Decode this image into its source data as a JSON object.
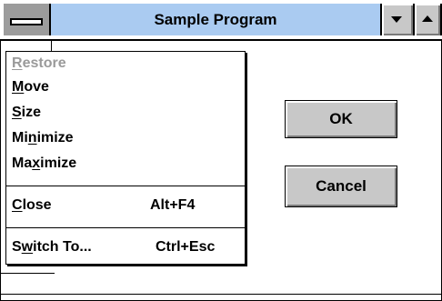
{
  "window": {
    "title": "Sample Program",
    "system_menu_icon": "system-menu-bar-icon",
    "minimize_icon": "arrow-down-icon",
    "maximize_icon": "arrow-up-icon"
  },
  "dialog": {
    "ok_label": "OK",
    "cancel_label": "Cancel"
  },
  "system_menu": {
    "items": [
      {
        "prefix": "",
        "mnemonic": "R",
        "suffix": "estore",
        "accel": "",
        "enabled": false
      },
      {
        "prefix": "",
        "mnemonic": "M",
        "suffix": "ove",
        "accel": "",
        "enabled": true
      },
      {
        "prefix": "",
        "mnemonic": "S",
        "suffix": "ize",
        "accel": "",
        "enabled": true
      },
      {
        "prefix": "Mi",
        "mnemonic": "n",
        "suffix": "imize",
        "accel": "",
        "enabled": true
      },
      {
        "prefix": "Ma",
        "mnemonic": "x",
        "suffix": "imize",
        "accel": "",
        "enabled": true
      },
      {
        "prefix": "",
        "mnemonic": "C",
        "suffix": "lose",
        "accel": "Alt+F4",
        "enabled": true
      },
      {
        "prefix": "S",
        "mnemonic": "w",
        "suffix": "itch To...",
        "accel": "Ctrl+Esc",
        "enabled": true
      }
    ]
  },
  "colors": {
    "title_bar": "#aacbf1",
    "button_face": "#c8c8c8",
    "sysmenu_box": "#9c9c9c",
    "disabled_text": "#9a9a9a"
  }
}
